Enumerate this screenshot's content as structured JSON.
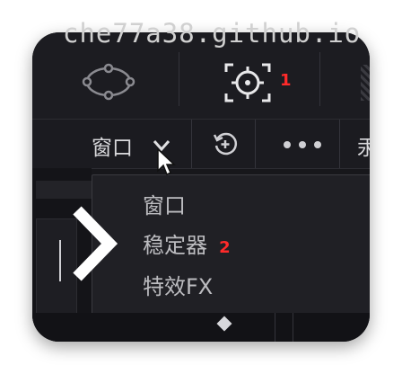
{
  "watermark": "che77a38.github.io",
  "toolbar": {
    "marker_1": "1",
    "dropdown_label": "窗口",
    "truncated_label": "汞"
  },
  "menu": {
    "items": [
      {
        "label": "窗口"
      },
      {
        "label": "稳定器",
        "marker": "2"
      },
      {
        "label": "特效FX"
      }
    ]
  },
  "colors": {
    "accent_red": "#ff2a2a",
    "panel_bg": "#1c1c21"
  }
}
